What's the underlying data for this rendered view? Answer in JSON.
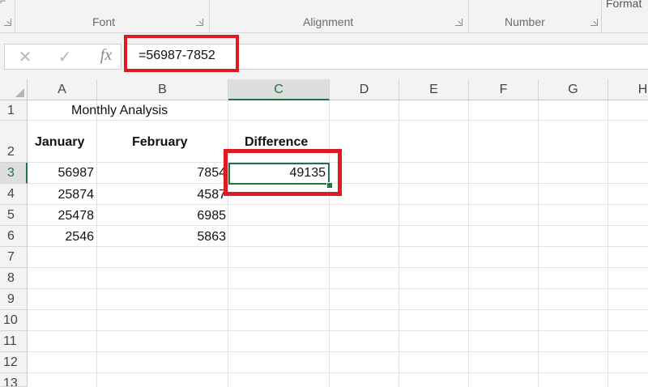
{
  "ribbon": {
    "groups": [
      {
        "label": "Font"
      },
      {
        "label": "Alignment"
      },
      {
        "label": "Number"
      }
    ],
    "next_group_label": "Format"
  },
  "formula_bar": {
    "cancel_symbol": "✕",
    "enter_symbol": "✓",
    "fx_label": "fx",
    "formula": "=56987-7852"
  },
  "columns": [
    "A",
    "B",
    "C",
    "D",
    "E",
    "F",
    "G",
    "H"
  ],
  "active_column": "C",
  "rows": [
    "1",
    "2",
    "3",
    "4",
    "5",
    "6",
    "7",
    "8",
    "9",
    "10",
    "11",
    "12",
    "13"
  ],
  "active_row": "3",
  "cells": {
    "A1": "Monthly Analysis",
    "A2": "January",
    "B2": "February",
    "C2": "Difference",
    "A3": "56987",
    "B3": "7854",
    "C3": "49135",
    "A4": "25874",
    "B4": "4587",
    "A5": "25478",
    "B5": "6985",
    "A6": "2546",
    "B6": "5863"
  },
  "colors": {
    "highlight": "#e01a22",
    "selection": "#217346"
  }
}
